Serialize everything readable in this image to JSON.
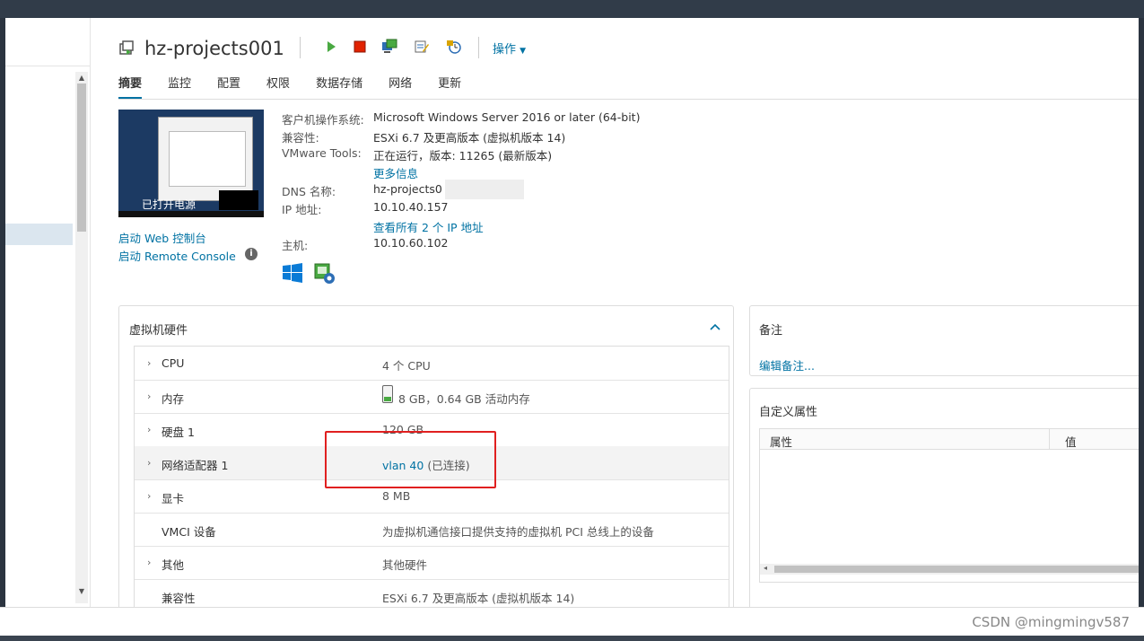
{
  "vm": {
    "name": "hz-projects001"
  },
  "toolbar": {
    "actions_label": "操作"
  },
  "tabs": [
    "摘要",
    "监控",
    "配置",
    "权限",
    "数据存储",
    "网络",
    "更新"
  ],
  "console": {
    "status": "已打开电源",
    "web_console": "启动 Web 控制台",
    "remote_console": "启动 Remote Console"
  },
  "summary": {
    "guest_os_label": "客户机操作系统:",
    "guest_os_value": "Microsoft Windows Server 2016 or later (64-bit)",
    "compat_label": "兼容性:",
    "compat_value": "ESXi 6.7 及更高版本 (虚拟机版本 14)",
    "tools_label": "VMware Tools:",
    "tools_value": "正在运行，版本: 11265 (最新版本)",
    "more_info": "更多信息",
    "dns_label": "DNS 名称:",
    "dns_value": "hz-projects0",
    "ip_label": "IP 地址:",
    "ip_value": "10.10.40.157",
    "all_ips": "查看所有 2 个 IP 地址",
    "host_label": "主机:",
    "host_value": "10.10.60.102"
  },
  "hardware": {
    "title": "虚拟机硬件",
    "rows": [
      {
        "key": "CPU",
        "value": "4 个 CPU",
        "expandable": true
      },
      {
        "key": "内存",
        "value": "8 GB，0.64 GB 活动内存",
        "expandable": true
      },
      {
        "key": "硬盘 1",
        "value": "120 GB",
        "expandable": true
      },
      {
        "key": "网络适配器 1",
        "value_link": "vlan 40",
        "value_suffix": "(已连接)",
        "expandable": true
      },
      {
        "key": "显卡",
        "value": "8 MB",
        "expandable": true
      },
      {
        "key": "VMCI 设备",
        "value": "为虚拟机通信接口提供支持的虚拟机 PCI 总线上的设备",
        "expandable": false
      },
      {
        "key": "其他",
        "value": "其他硬件",
        "expandable": true
      },
      {
        "key": "兼容性",
        "value": "ESXi 6.7 及更高版本 (虚拟机版本 14)",
        "expandable": false
      }
    ]
  },
  "notes": {
    "title": "备注",
    "edit": "编辑备注..."
  },
  "custom_attrs": {
    "title": "自定义属性",
    "col_attr": "属性",
    "col_value": "值"
  },
  "watermark": "CSDN @mingmingv587",
  "colors": {
    "accent": "#0072a3",
    "highlight_box": "#e02020",
    "power_on": "#49a942",
    "power_off": "#e12200"
  }
}
